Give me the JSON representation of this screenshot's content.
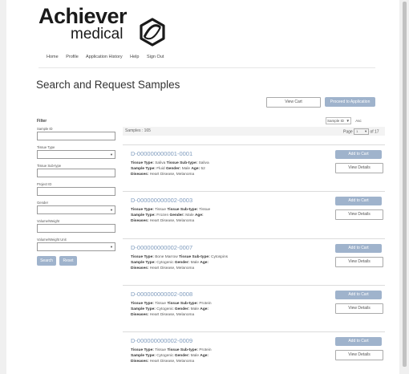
{
  "brand": {
    "line1": "Achiever",
    "line2": "medical"
  },
  "nav": [
    "Home",
    "Profile",
    "Application History",
    "Help",
    "Sign Out"
  ],
  "page_title": "Search and Request Samples",
  "buttons": {
    "view_cart": "View Cart",
    "proceed": "Proceed to Application"
  },
  "filter": {
    "heading": "Filter",
    "sample_id_label": "Sample ID",
    "tissue_type_label": "Tissue Type",
    "tissue_sub_type_label": "Tissue Sub-type",
    "project_id_label": "Project ID",
    "gender_label": "Gender",
    "volume_weight_label": "Volume/Weight",
    "volume_weight_unit_label": "Volume/Weight Unit",
    "search_button": "Search",
    "reset_button": "Reset"
  },
  "samples_count": "Samples : 165",
  "sort": {
    "selected": "Sample ID",
    "direction": "Asc"
  },
  "pagination": {
    "prefix": "Page",
    "page": "1",
    "suffix": "of 17"
  },
  "card_labels": {
    "tissue_type": "Tissue Type:",
    "tissue_sub_type": "Tissue Sub-type:",
    "sample_type": "Sample Type:",
    "gender": "Gender:",
    "age": "Age:",
    "diseases": "Diseases:",
    "add_to_cart": "Add to Cart",
    "view_details": "View Details"
  },
  "samples": [
    {
      "id": "D-000000000001-0001",
      "tissue_type": "Saliva",
      "tissue_sub_type": "Saliva",
      "sample_type": "Fluid",
      "gender": "Male",
      "age": "52",
      "diseases": "Heart Disease, Melanoma"
    },
    {
      "id": "D-000000000002-0003",
      "tissue_type": "Tissue",
      "tissue_sub_type": "Tissue",
      "sample_type": "Frozen",
      "gender": "Male",
      "age": "",
      "diseases": "Heart Disease, Melanoma"
    },
    {
      "id": "D-000000000002-0007",
      "tissue_type": "Bone Marrow",
      "tissue_sub_type": "Cytospins",
      "sample_type": "Cytogenic",
      "gender": "Male",
      "age": "",
      "diseases": "Heart Disease, Melanoma"
    },
    {
      "id": "D-000000000002-0008",
      "tissue_type": "Tissue",
      "tissue_sub_type": "Protein",
      "sample_type": "Cytogenic",
      "gender": "Male",
      "age": "",
      "diseases": "Heart Disease, Melanoma"
    },
    {
      "id": "D-000000000002-0009",
      "tissue_type": "Tissue",
      "tissue_sub_type": "Protein",
      "sample_type": "Cytogenic",
      "gender": "Male",
      "age": "",
      "diseases": "Heart Disease, Melanoma"
    }
  ]
}
